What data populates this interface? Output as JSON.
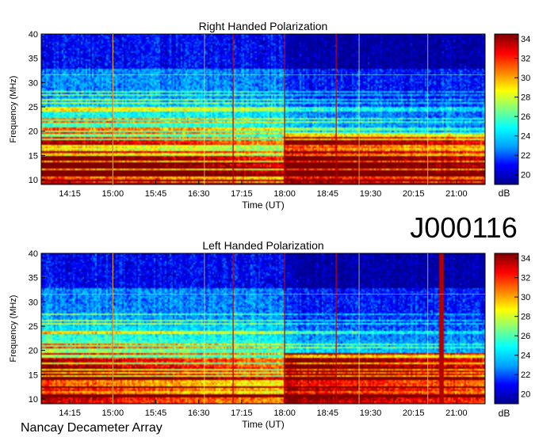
{
  "chart_data": [
    {
      "type": "heatmap",
      "title": "Right Handed Polarization",
      "xlabel": "Time (UT)",
      "ylabel": "Frequency (MHz)",
      "x_ticks": [
        "14:15",
        "15:00",
        "15:45",
        "16:30",
        "17:15",
        "18:00",
        "18:45",
        "19:30",
        "20:15",
        "21:00"
      ],
      "y_ticks": [
        "10",
        "15",
        "20",
        "25",
        "30",
        "35",
        "40"
      ],
      "ylim": [
        10,
        40
      ],
      "colorbar": {
        "label": "dB",
        "ticks": [
          "20",
          "22",
          "24",
          "26",
          "28",
          "30",
          "32",
          "34"
        ],
        "range": [
          19,
          34.5
        ]
      },
      "colormap": [
        "#00008f",
        "#0000ff",
        "#00a0ff",
        "#00ffff",
        "#80ff80",
        "#ffff00",
        "#ff8000",
        "#ff0000",
        "#800000"
      ]
    },
    {
      "type": "heatmap",
      "title": "Left Handed Polarization",
      "xlabel": "Time (UT)",
      "ylabel": "Frequency (MHz)",
      "x_ticks": [
        "14:15",
        "15:00",
        "15:45",
        "16:30",
        "17:15",
        "18:00",
        "18:45",
        "19:30",
        "20:15",
        "21:00"
      ],
      "y_ticks": [
        "10",
        "15",
        "20",
        "25",
        "30",
        "35",
        "40"
      ],
      "ylim": [
        10,
        40
      ],
      "colorbar": {
        "label": "dB",
        "ticks": [
          "20",
          "22",
          "24",
          "26",
          "28",
          "30",
          "32",
          "34"
        ],
        "range": [
          19,
          34.5
        ]
      },
      "colormap": [
        "#00008f",
        "#0000ff",
        "#00a0ff",
        "#00ffff",
        "#80ff80",
        "#ffff00",
        "#ff8000",
        "#ff0000",
        "#800000"
      ]
    }
  ],
  "header": {
    "id_label": "J000116"
  },
  "footer": {
    "observatory": "Nancay Decameter Array"
  }
}
